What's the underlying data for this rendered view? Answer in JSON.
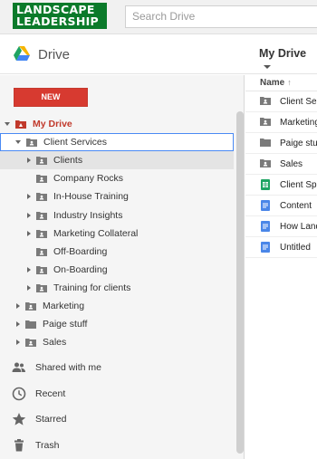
{
  "logo": {
    "line1": "LANDSCAPE",
    "line2": "LEADERSHIP"
  },
  "search": {
    "placeholder": "Search Drive"
  },
  "drive": {
    "title": "Drive",
    "my_drive_button": "My Drive"
  },
  "sidebar": {
    "new_label": "NEW",
    "tree": [
      {
        "label": "My Drive",
        "expand": "down",
        "icon": "my-drive-icon",
        "level": 0
      },
      {
        "label": "Client Services",
        "expand": "down",
        "icon": "shared-folder-icon",
        "level": 1,
        "selected": true
      },
      {
        "label": "Clients",
        "expand": "right",
        "icon": "shared-folder-icon",
        "level": 2,
        "highlight": true
      },
      {
        "label": "Company Rocks",
        "expand": "none",
        "icon": "shared-folder-icon",
        "level": 2
      },
      {
        "label": "In-House Training",
        "expand": "right",
        "icon": "shared-folder-icon",
        "level": 2
      },
      {
        "label": "Industry Insights",
        "expand": "right",
        "icon": "shared-folder-icon",
        "level": 2
      },
      {
        "label": "Marketing Collateral",
        "expand": "right",
        "icon": "shared-folder-icon",
        "level": 2
      },
      {
        "label": "Off-Boarding",
        "expand": "none",
        "icon": "shared-folder-icon",
        "level": 2
      },
      {
        "label": "On-Boarding",
        "expand": "right",
        "icon": "shared-folder-icon",
        "level": 2
      },
      {
        "label": "Training for clients",
        "expand": "right",
        "icon": "shared-folder-icon",
        "level": 2
      },
      {
        "label": "Marketing",
        "expand": "right",
        "icon": "shared-folder-icon",
        "level": 1
      },
      {
        "label": "Paige stuff",
        "expand": "right",
        "icon": "folder-icon",
        "level": 1
      },
      {
        "label": "Sales",
        "expand": "right",
        "icon": "shared-folder-icon",
        "level": 1
      }
    ],
    "nav": [
      {
        "label": "Shared with me",
        "icon": "people-icon"
      },
      {
        "label": "Recent",
        "icon": "clock-icon"
      },
      {
        "label": "Starred",
        "icon": "star-icon"
      },
      {
        "label": "Trash",
        "icon": "trash-icon"
      }
    ]
  },
  "list": {
    "header": "Name",
    "sort_arrow": "↑",
    "rows": [
      {
        "name": "Client Services",
        "icon": "shared-folder-icon"
      },
      {
        "name": "Marketing",
        "icon": "shared-folder-icon"
      },
      {
        "name": "Paige stuff",
        "icon": "folder-icon"
      },
      {
        "name": "Sales",
        "icon": "shared-folder-icon"
      },
      {
        "name": "Client Spreadsheet",
        "icon": "sheets-icon"
      },
      {
        "name": "Content",
        "icon": "docs-icon"
      },
      {
        "name": "How Landscape",
        "icon": "docs-icon"
      },
      {
        "name": "Untitled",
        "icon": "docs-icon"
      }
    ]
  },
  "colors": {
    "accent_red": "#d73a30",
    "logo_green": "#0b7a2a",
    "selection_blue": "#4a8af4"
  }
}
